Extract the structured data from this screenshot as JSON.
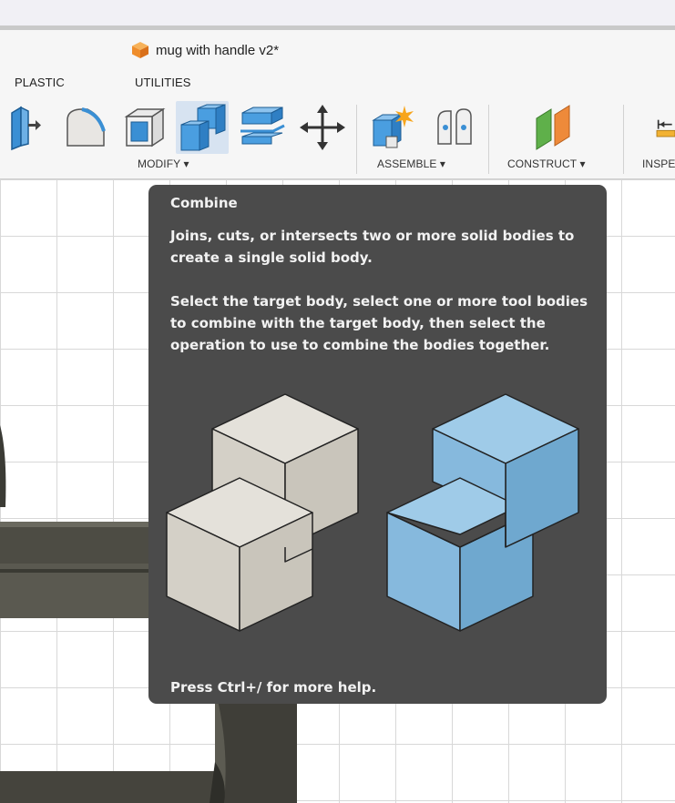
{
  "document": {
    "title": "mug with handle v2*"
  },
  "tabs": {
    "plastic": "PLASTIC",
    "utilities": "UTILITIES"
  },
  "groups": {
    "modify": "MODIFY ▾",
    "assemble": "ASSEMBLE ▾",
    "construct": "CONSTRUCT ▾",
    "inspect": "INSPE"
  },
  "icons": {
    "press_pull": "press-pull-icon",
    "fillet": "fillet-icon",
    "shell": "shell-icon",
    "combine": "combine-icon",
    "split_face": "split-face-icon",
    "move": "move-icon",
    "new_component": "new-component-icon",
    "joint": "joint-icon",
    "offset_plane": "offset-plane-icon",
    "measure": "measure-icon"
  },
  "tooltip": {
    "title": "Combine",
    "description": "Joins, cuts, or intersects two or more solid bodies to create a single solid body.",
    "instructions": "Select the target body, select one or more tool bodies to combine with the target body, then select the operation to use to combine the bodies together.",
    "help": "Press Ctrl+/ for more help."
  },
  "colors": {
    "tooltip_bg": "#4b4b4b",
    "active_tool_bg": "#d7e3f1",
    "body_blue": "#7fb4d8",
    "body_beige": "#ddd9d0"
  }
}
